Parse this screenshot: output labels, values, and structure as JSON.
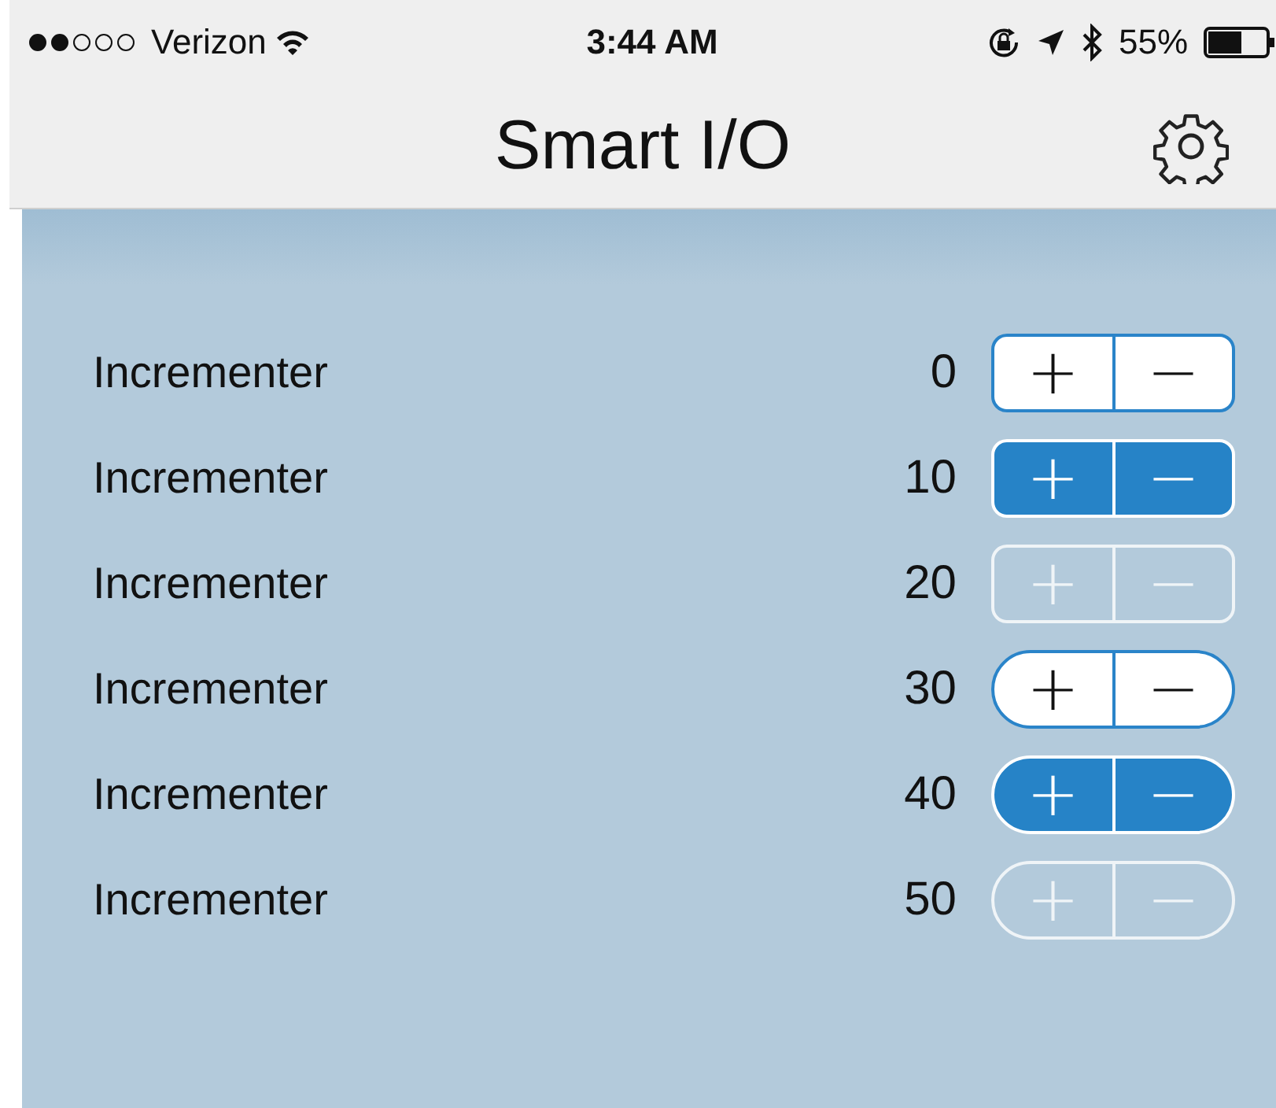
{
  "status_bar": {
    "carrier": "Verizon",
    "time": "3:44 AM",
    "battery": "55%"
  },
  "nav_bar": {
    "title": "Smart I/O"
  },
  "rows": [
    {
      "label": "Incrementer",
      "value": "0",
      "kind": "light",
      "pill": false,
      "plus": "+",
      "minus": "−"
    },
    {
      "label": "Incrementer",
      "value": "10",
      "kind": "filled",
      "pill": false,
      "plus": "+",
      "minus": "−"
    },
    {
      "label": "Incrementer",
      "value": "20",
      "kind": "clear",
      "pill": false,
      "plus": "+",
      "minus": "−"
    },
    {
      "label": "Incrementer",
      "value": "30",
      "kind": "light",
      "pill": true,
      "plus": "+",
      "minus": "−"
    },
    {
      "label": "Incrementer",
      "value": "40",
      "kind": "filled",
      "pill": true,
      "plus": "+",
      "minus": "−"
    },
    {
      "label": "Incrementer",
      "value": "50",
      "kind": "clear",
      "pill": true,
      "plus": "+",
      "minus": "−"
    }
  ]
}
